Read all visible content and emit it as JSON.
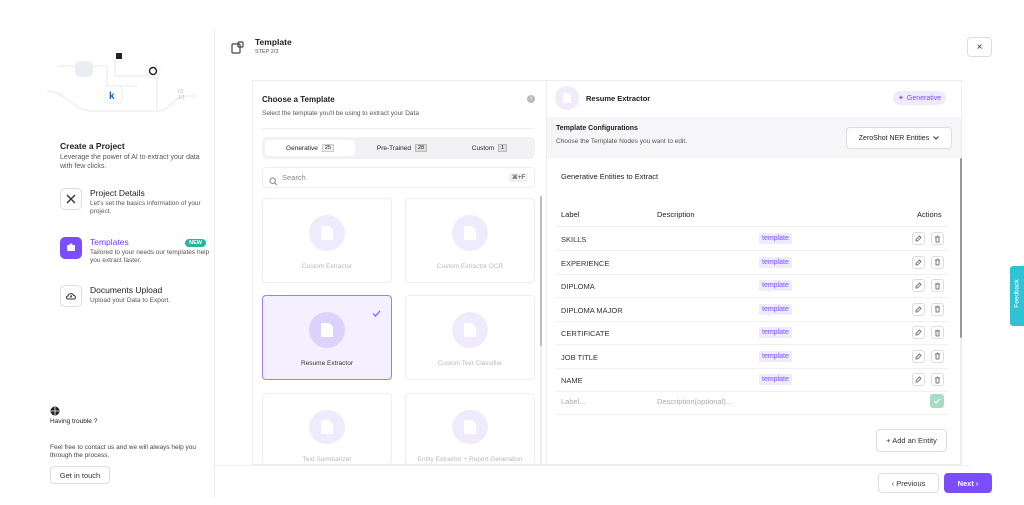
{
  "sidebar": {
    "title": "Create a Project",
    "subtitle": "Leverage the power of AI to extract your data with few clicks.",
    "steps": [
      {
        "title": "Project Details",
        "desc": "Let's set the basics information of your project.",
        "icon": "wrench-cross-icon"
      },
      {
        "title": "Templates",
        "desc": "Tailored to your needs our templates help you extract faster.",
        "icon": "puzzle-icon",
        "badge": "NEW"
      },
      {
        "title": "Documents Upload",
        "desc": "Upload your Data to Export.",
        "icon": "cloud-upload-icon"
      }
    ],
    "help_title": "Having trouble ?",
    "help_text": "Feel free to contact us and we will always help you through the process.",
    "contact_label": "Get in touch",
    "illus_small": "01\n1/1"
  },
  "header": {
    "title": "Template",
    "step": "STEP 2/3",
    "close": "×"
  },
  "left_panel": {
    "title": "Choose a Template",
    "subtitle": "Select the template you'll be using to extract your Data",
    "tabs": [
      {
        "label": "Generative",
        "count": "25"
      },
      {
        "label": "Pre-Trained",
        "count": "28"
      },
      {
        "label": "Custom",
        "count": "1"
      }
    ],
    "search_placeholder": "Search",
    "search_shortcut": "⌘+F",
    "cards": [
      "Custom Extractor",
      "Custom Extractor OCR",
      "Resume Extractor",
      "Custom Text Classifier",
      "Text Summarizer",
      "Entity Extractor + Report Generation"
    ]
  },
  "right_panel": {
    "name": "Resume Extractor",
    "badge": "Generative",
    "config_title": "Template Configurations",
    "config_sub": "Choose the Template Nodes you want to edit.",
    "dropdown": "ZeroShot NER Entities",
    "section_title": "Generative Entities to Extract",
    "col_label": "Label",
    "col_desc": "Description",
    "col_actions": "Actions",
    "entities": [
      {
        "label": "SKILLS",
        "tag": "template"
      },
      {
        "label": "EXPERIENCE",
        "tag": "template"
      },
      {
        "label": "DIPLOMA",
        "tag": "template"
      },
      {
        "label": "DIPLOMA MAJOR",
        "tag": "template"
      },
      {
        "label": "CERTIFICATE",
        "tag": "template"
      },
      {
        "label": "JOB TITLE",
        "tag": "template"
      },
      {
        "label": "NAME",
        "tag": "template"
      }
    ],
    "new_label_placeholder": "Label...",
    "new_desc_placeholder": "Description(optional)...",
    "add_entity": "+ Add an Entity"
  },
  "footer": {
    "previous": "‹  Previous",
    "next": "Next  ›"
  },
  "feedback_tab": "Feedback",
  "colors": {
    "accent": "#7c4dff",
    "teal": "#2bb39b",
    "feedback": "#2ec4d6"
  }
}
